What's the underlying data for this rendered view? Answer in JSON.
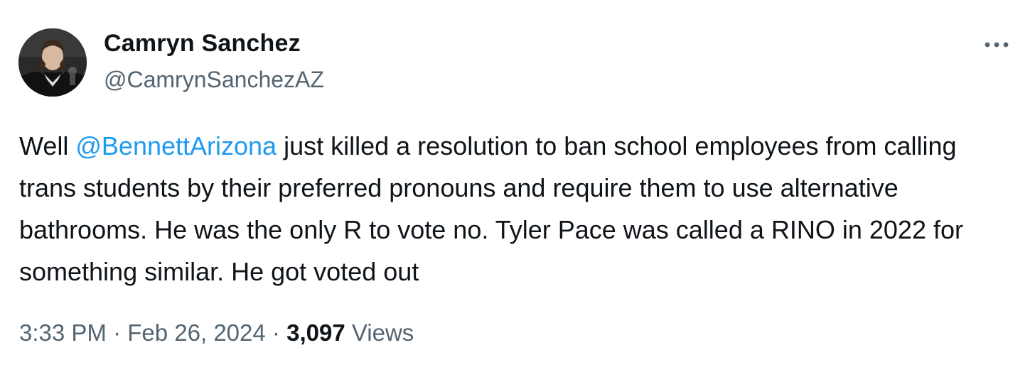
{
  "author": {
    "display_name": "Camryn Sanchez",
    "handle": "@CamrynSanchezAZ"
  },
  "more_icon": "more-horizontal-icon",
  "tweet": {
    "text_before": "Well ",
    "mention": "@BennettArizona",
    "text_after": " just killed a resolution to ban school employees from calling trans students by their preferred pronouns and require them to use alternative bathrooms. He was the only R to vote no. Tyler Pace was called a RINO in 2022 for something similar. He got voted out"
  },
  "meta": {
    "time": "3:33 PM",
    "separator": "·",
    "date": "Feb 26, 2024",
    "views_count": "3,097",
    "views_label": "Views"
  },
  "colors": {
    "text": "#0f1419",
    "secondary": "#536471",
    "link": "#1d9bf0"
  }
}
